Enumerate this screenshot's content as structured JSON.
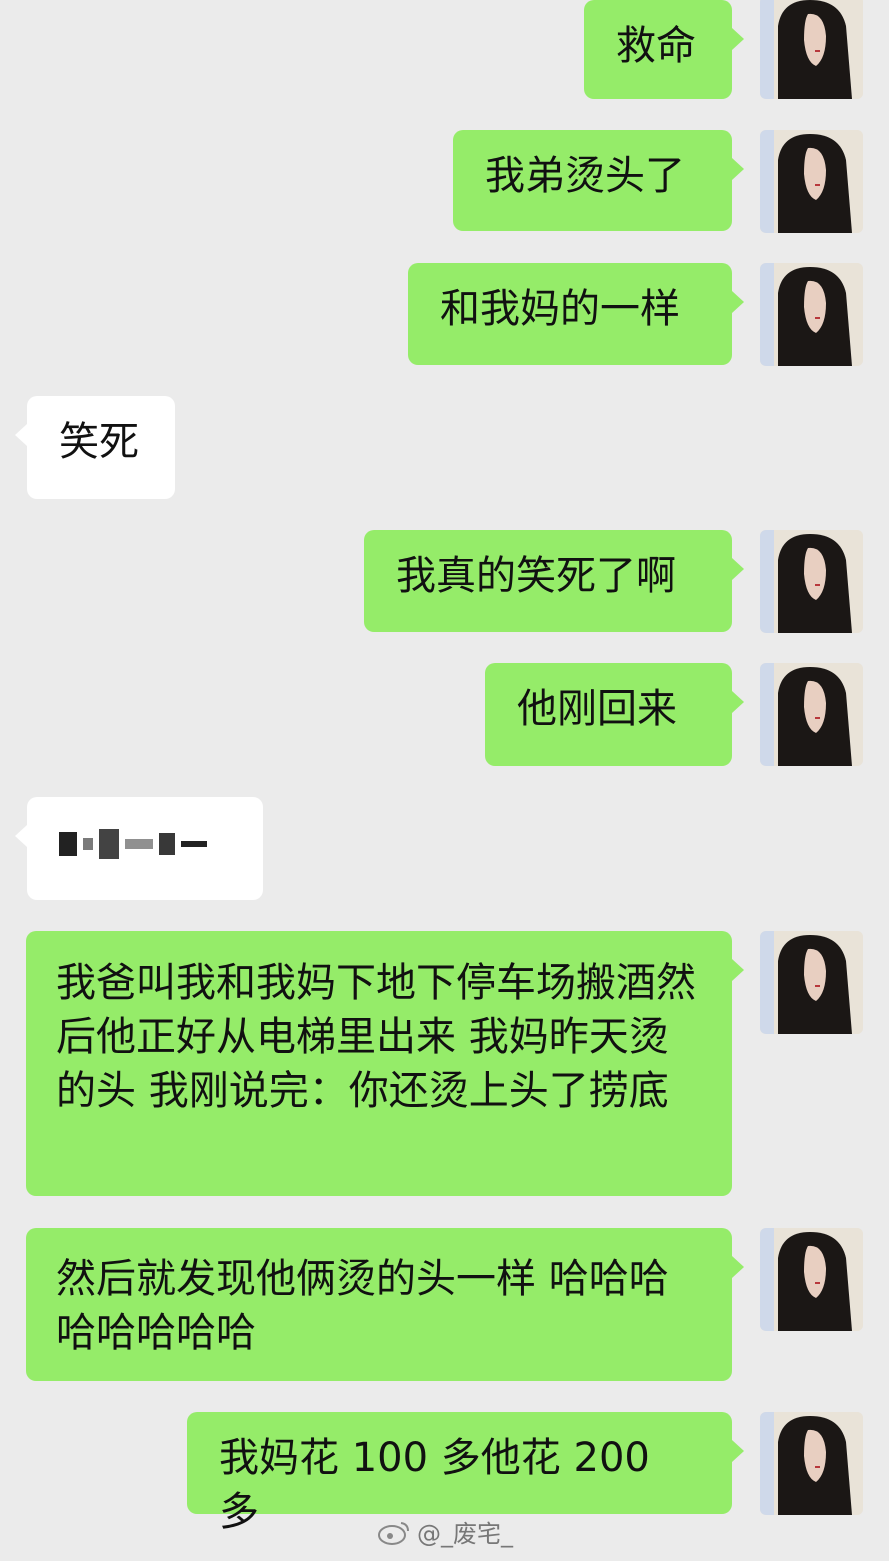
{
  "messages": [
    {
      "side": "out",
      "text": "救命"
    },
    {
      "side": "out",
      "text": "我弟烫头了"
    },
    {
      "side": "out",
      "text": "和我妈的一样"
    },
    {
      "side": "in",
      "text": "笑死"
    },
    {
      "side": "out",
      "text": "我真的笑死了啊"
    },
    {
      "side": "out",
      "text": "他刚回来"
    },
    {
      "side": "in",
      "text": ""
    },
    {
      "side": "out",
      "text": "我爸叫我和我妈下地下停车场搬酒然后他正好从电梯里出来 我妈昨天烫的头 我刚说完：你还烫上头了捞底"
    },
    {
      "side": "out",
      "text": "然后就发现他俩烫的头一样 哈哈哈哈哈哈哈哈"
    },
    {
      "side": "out",
      "text": "我妈花 100 多他花 200 多"
    }
  ],
  "watermark": {
    "icon": "weibo-icon",
    "text": "@_废宅_"
  },
  "colors": {
    "background": "#ebebeb",
    "outgoing_bubble": "#95ec69",
    "incoming_bubble": "#ffffff"
  }
}
